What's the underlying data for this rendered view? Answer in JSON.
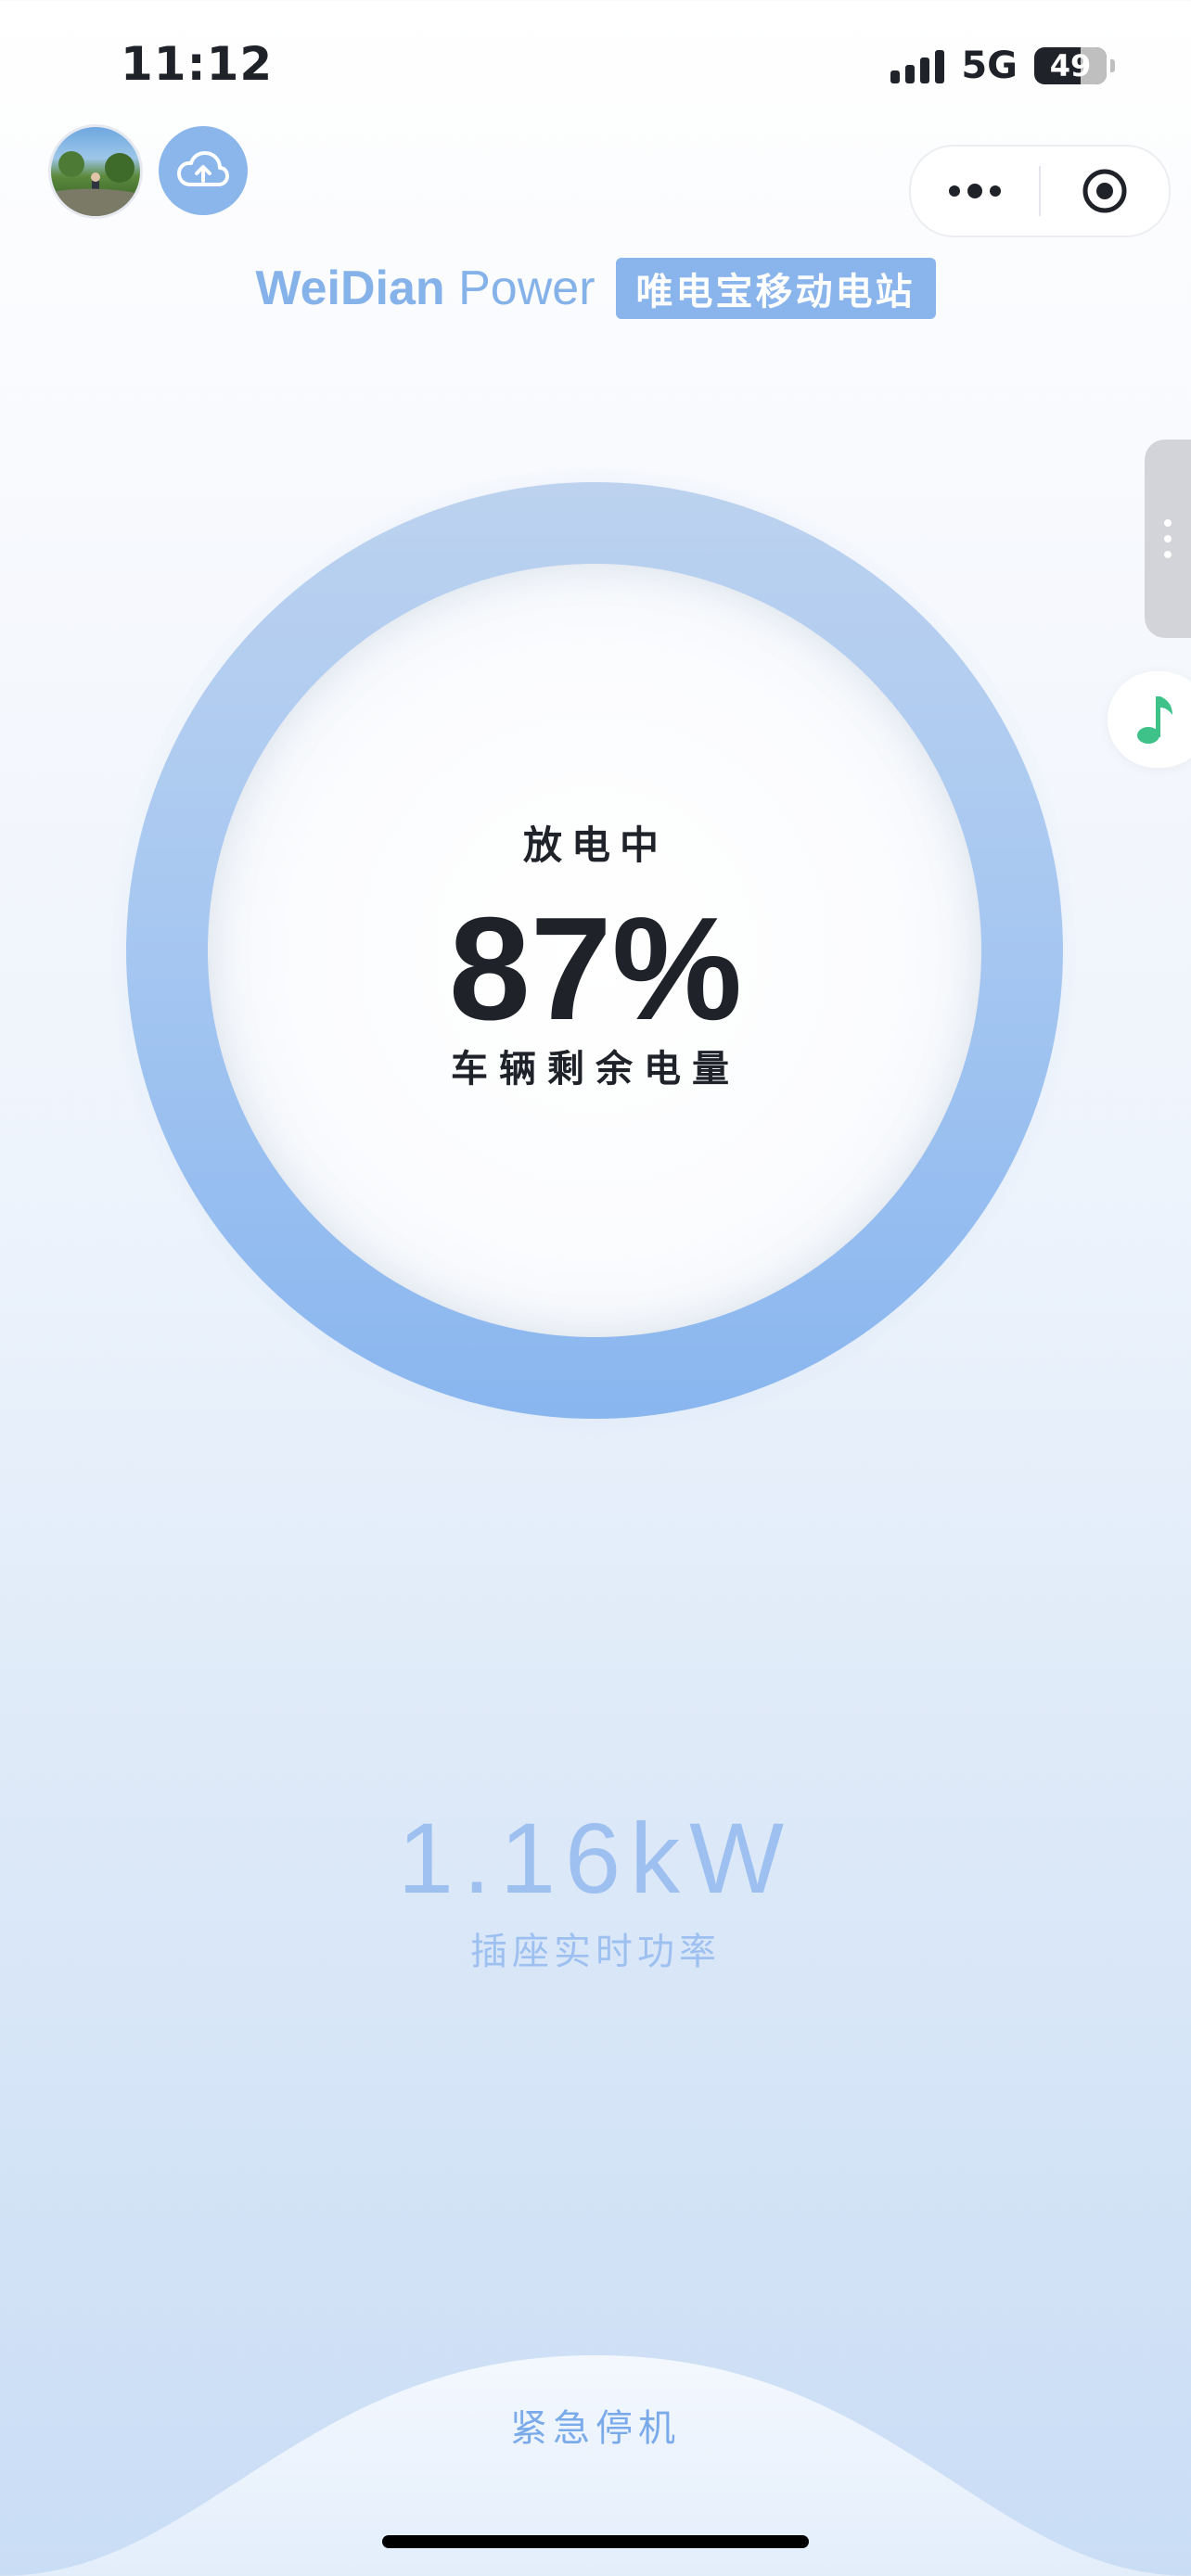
{
  "status_bar": {
    "time": "11:12",
    "network": "5G",
    "battery": "49"
  },
  "brand": {
    "name_bold": "WeiDian",
    "name_light": "Power",
    "tagline": "唯电宝移动电站"
  },
  "battery_ring": {
    "status": "放电中",
    "percent": "87%",
    "percent_value": 0.87,
    "label": "车辆剩余电量"
  },
  "power": {
    "value": "1.16kW",
    "label": "插座实时功率"
  },
  "actions": {
    "emergency_stop": "紧急停机"
  },
  "icons": {
    "avatar": "avatar",
    "cloud": "cloud-upload-icon",
    "more": "more-dots-icon",
    "close": "target-close-icon",
    "side": "side-handle-icon",
    "music": "music-note-icon"
  },
  "colors": {
    "accent": "#8ab4ec",
    "ring_top": "#bcd2ef",
    "ring_bottom": "#89b6ef",
    "music_green": "#3ec28a"
  }
}
